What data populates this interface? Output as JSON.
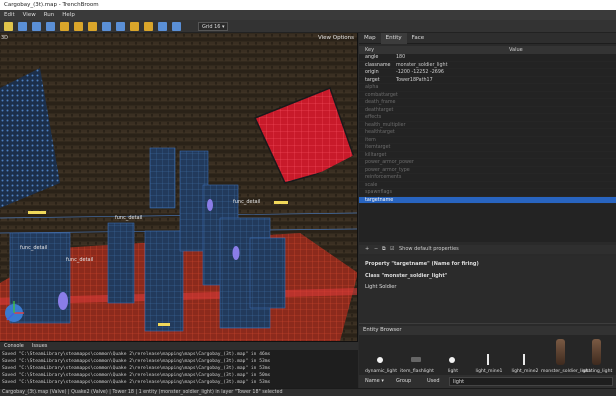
{
  "window": {
    "title": "Cargobay_(3t).map - TrenchBroom"
  },
  "menu": [
    "Edit",
    "View",
    "Run",
    "Help"
  ],
  "toolbar": {
    "grid_label": "Grid 16",
    "colors": [
      "#e0c44a",
      "#5a8fd6",
      "#5a8fd6",
      "#5a8fd6",
      "#d9a52a",
      "#d9a52a",
      "#d9a52a",
      "#5a8fd6",
      "#5a8fd6",
      "#d9a52a",
      "#d9a52a",
      "#5a8fd6",
      "#5a8fd6"
    ]
  },
  "viewport": {
    "camera_label": "3D",
    "view_options_label": "View Options",
    "func_labels": [
      "func_detail",
      "func_detail",
      "func_detail",
      "func_detail"
    ]
  },
  "console": {
    "tabs": [
      "Console",
      "Issues"
    ],
    "lines": [
      "Saved \"C:\\SteamLibrary\\steamapps\\common\\Quake 2\\rerelease\\mapping\\maps\\Cargobay_(3t).map\" in 46ms",
      "Saved \"C:\\SteamLibrary\\steamapps\\common\\Quake 2\\rerelease\\mapping\\maps\\Cargobay_(3t).map\" in 53ms",
      "Saved \"C:\\SteamLibrary\\steamapps\\common\\Quake 2\\rerelease\\mapping\\maps\\Cargobay_(3t).map\" in 53ms",
      "Saved \"C:\\SteamLibrary\\steamapps\\common\\Quake 2\\rerelease\\mapping\\maps\\Cargobay_(3t).map\" in 50ms",
      "Saved \"C:\\SteamLibrary\\steamapps\\common\\Quake 2\\rerelease\\mapping\\maps\\Cargobay_(3t).map\" in 53ms"
    ]
  },
  "statusbar": {
    "text": "Cargobay_(3t).map (Valve) | Quake2 (Valve) | Tower 18 | 1 entity (monster_soldier_light) in layer \"Tower 18\" selected"
  },
  "inspector": {
    "tabs": [
      "Map",
      "Entity",
      "Face"
    ],
    "active_tab": "Entity",
    "columns": {
      "key": "Key",
      "value": "Value"
    },
    "properties": [
      {
        "key": "angle",
        "value": "180",
        "set": true
      },
      {
        "key": "classname",
        "value": "monster_soldier_light",
        "set": true
      },
      {
        "key": "origin",
        "value": "-1200 -12252 -2696",
        "set": true
      },
      {
        "key": "target",
        "value": "Tower18Path17",
        "set": true
      },
      {
        "key": "alpha",
        "value": "",
        "set": false
      },
      {
        "key": "combattarget",
        "value": "",
        "set": false
      },
      {
        "key": "death_frame",
        "value": "",
        "set": false
      },
      {
        "key": "deathtarget",
        "value": "",
        "set": false
      },
      {
        "key": "effects",
        "value": "",
        "set": false
      },
      {
        "key": "health_multiplier",
        "value": "",
        "set": false
      },
      {
        "key": "healthtarget",
        "value": "",
        "set": false
      },
      {
        "key": "item",
        "value": "",
        "set": false
      },
      {
        "key": "itemtarget",
        "value": "",
        "set": false
      },
      {
        "key": "killtarget",
        "value": "",
        "set": false
      },
      {
        "key": "power_armor_power",
        "value": "",
        "set": false
      },
      {
        "key": "power_armor_type",
        "value": "",
        "set": false
      },
      {
        "key": "reinforcements",
        "value": "",
        "set": false
      },
      {
        "key": "scale",
        "value": "",
        "set": false
      },
      {
        "key": "spawnflags",
        "value": "",
        "set": false
      },
      {
        "key": "targetname",
        "value": "",
        "set": false
      }
    ],
    "selected_key": "targetname",
    "show_default_label": "Show default properties",
    "doc": {
      "property_line": "Property \"targetname\" (Name for firing)",
      "class_line": "Class \"monster_soldier_light\"",
      "desc": "Light Soldier"
    }
  },
  "entity_browser": {
    "title": "Entity Browser",
    "items": [
      "dynamic_light",
      "item_flashlight",
      "light",
      "light_mine1",
      "light_mine2",
      "monster_soldier_light",
      "rotating_light"
    ],
    "sort_label": "Name",
    "group_label": "Group",
    "used_label": "Used",
    "filter_value": "light"
  }
}
